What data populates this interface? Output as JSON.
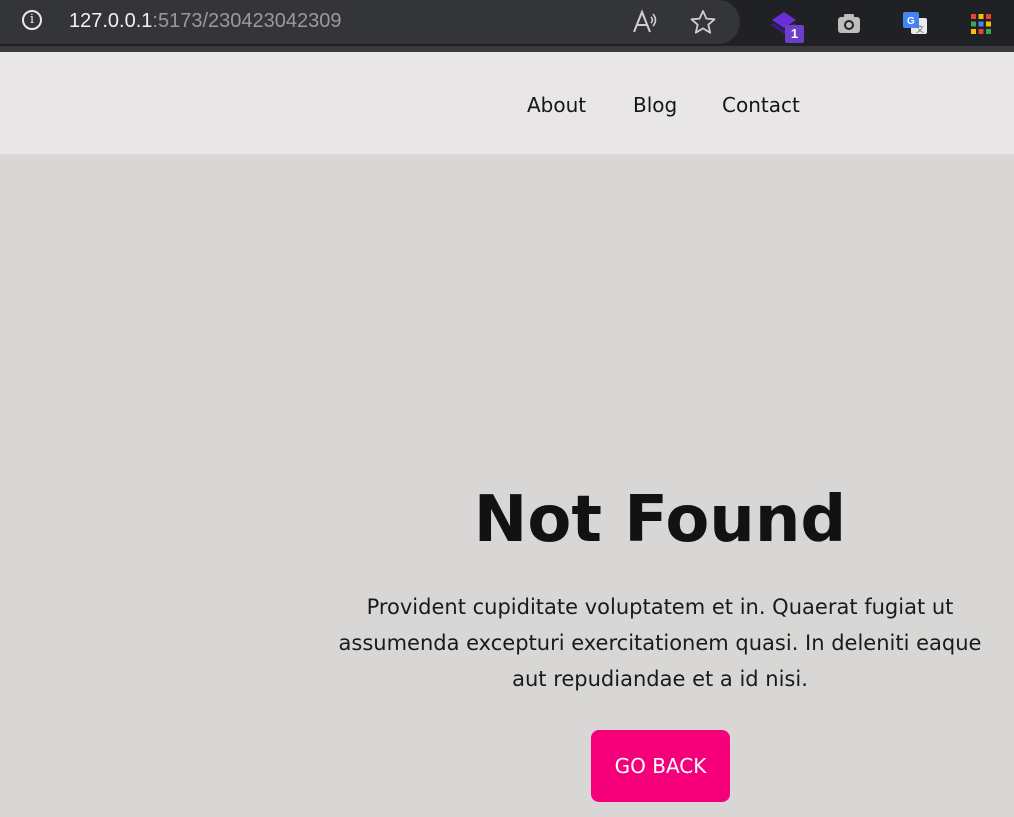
{
  "browser": {
    "url_host": "127.0.0.1",
    "url_rest": ":5173/230423042309",
    "extension_badge": "1",
    "icons": [
      "info-icon",
      "read-aloud-icon",
      "favorite-star-icon",
      "extension-stack-icon",
      "camera-icon",
      "google-translate-icon",
      "apps-grid-icon"
    ]
  },
  "nav": {
    "items": [
      {
        "label": "About"
      },
      {
        "label": "Blog"
      },
      {
        "label": "Contact"
      }
    ]
  },
  "main": {
    "title": "Not Found",
    "description": "Provident cupiditate voluptatem et in. Quaerat fugiat ut assumenda excepturi exercitationem quasi. In deleniti eaque aut repudiandae et a id nisi.",
    "button_label": "GO BACK"
  },
  "colors": {
    "header_bg": "#e8e6e7",
    "page_bg": "#d8d7d5",
    "button_bg": "#f5007a",
    "browser_chrome": "#202124"
  }
}
